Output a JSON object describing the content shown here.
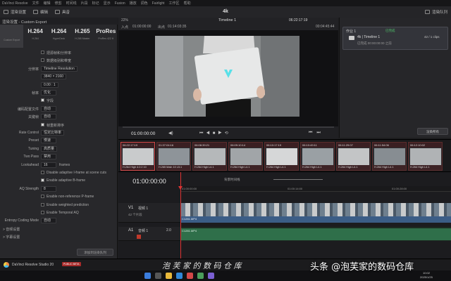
{
  "menubar": {
    "items": [
      "DaVinci Resolve",
      "文件",
      "编辑",
      "修剪",
      "时间线",
      "片段",
      "标记",
      "显示",
      "Fusion",
      "播放",
      "调色",
      "Fairlight",
      "工作区",
      "帮助"
    ]
  },
  "toolbar": {
    "render_label": "渲染设置",
    "media_label": "编辑",
    "quality_label": "具音",
    "project_title": "4k",
    "render_queue_label": "渲染队列"
  },
  "viewer": {
    "zoom": "22%",
    "tc_in": "01:00:00:00",
    "tc_out": "01:14:03:35",
    "timeline_name": "Timeline 1",
    "timecode": "06:22:17:19",
    "duration": "00:04:45:44",
    "in_label": "入点",
    "out_label": "出点",
    "current_tc": "01:00:00:00"
  },
  "left": {
    "header": "渲染设置 - Custom Export",
    "presets": [
      {
        "big": "",
        "small": "Custom Export"
      },
      {
        "big": "H.264",
        "small": "H.264"
      },
      {
        "big": "H.264",
        "small": "HyperDeck"
      },
      {
        "big": "H.265",
        "small": "H.265 Master"
      },
      {
        "big": "ProRes",
        "small": "ProRes 422 H"
      }
    ],
    "rows": [
      {
        "type": "check",
        "on": false,
        "text": "把源帧和分辨率"
      },
      {
        "type": "check",
        "on": false,
        "text": "数据级别和带宽"
      },
      {
        "label": "分辨率",
        "value": "Timeline Resolution"
      },
      {
        "label": "",
        "value": "3840  ×  2160"
      },
      {
        "label": "",
        "value": "0.00 : 1"
      },
      {
        "label": "帧率",
        "value": "优化"
      },
      {
        "type": "check",
        "on": true,
        "text": "字段"
      },
      {
        "label": "编码配置文件",
        "value": "自动"
      },
      {
        "label": "关键帧",
        "value": "自动"
      },
      {
        "type": "check",
        "on": true,
        "text": "帧重新排序"
      },
      {
        "label": "Rate Control",
        "value": "恒定比特率"
      },
      {
        "label": "Preset",
        "value": "慢速"
      },
      {
        "label": "Tuning",
        "value": "高质量"
      },
      {
        "label": "Two Pass",
        "value": "禁用"
      },
      {
        "label": "Lookahead",
        "value": "16",
        "suffix": "frames"
      },
      {
        "type": "check",
        "on": false,
        "text": "Disable adaptive I-frame at scene cuts"
      },
      {
        "type": "check",
        "on": true,
        "text": "Enable adaptive B-frame"
      },
      {
        "label": "AQ Strength",
        "value": "8"
      },
      {
        "type": "check",
        "on": false,
        "text": "Enable non-reference P-frame"
      },
      {
        "type": "check",
        "on": false,
        "text": "Enable weighted prediction"
      },
      {
        "type": "check",
        "on": false,
        "text": "Enable Temporal AQ"
      },
      {
        "label": "Entropy Coding Mode",
        "value": "自动"
      },
      {
        "type": "section",
        "text": "> 音频设置"
      },
      {
        "type": "section",
        "text": "> 字幕设置"
      }
    ],
    "render_button": "添加到渲染队列"
  },
  "queue": {
    "title": "渲染队列",
    "item": {
      "name": "作业 1",
      "timeline": "4k | Timeline 1",
      "detail": "42 / 1 clips",
      "status": "已完成",
      "subtext": "已完成 00:00:00:00 之前"
    },
    "button": "渲染所有"
  },
  "clips": [
    {
      "num": "01",
      "tc": "06:22:17:19",
      "name": "H.264 High 4:2:2 10"
    },
    {
      "num": "02",
      "tc": "01:37:04:16",
      "name": "H.265 Main 10 L5.1"
    },
    {
      "num": "03",
      "tc": "06:08:39:21",
      "name": "H.264 High L4.1"
    },
    {
      "num": "04",
      "tc": "06:09:10:14",
      "name": "H.264 High L4.1"
    },
    {
      "num": "05",
      "tc": "06:10:17:19",
      "name": "H.264 High L4.1"
    },
    {
      "num": "06",
      "tc": "06:10:49:11",
      "name": "H.264 High L4.1"
    },
    {
      "num": "07",
      "tc": "06:11:29:07",
      "name": "H.264 High L4.1"
    },
    {
      "num": "08",
      "tc": "06:11:54:06",
      "name": "H.264 High L4.1"
    },
    {
      "num": "09",
      "tc": "06:12:10:02",
      "name": "H.264 High L4.1"
    }
  ],
  "timeline": {
    "timecode": "01:00:00:00",
    "ruler": [
      "01:00:00:00",
      "01:00:14:00",
      "01:00:28:00"
    ],
    "v1": {
      "label": "V1",
      "name": "视频 1",
      "sub": "42 个片段",
      "clip": "C1281.MP4"
    },
    "a1": {
      "label": "A1",
      "name": "音频 1",
      "level": "2.0",
      "clip": "C1281.MP4"
    },
    "track_height_label": "背景时间线"
  },
  "bottombar": {
    "app": "DaVinci Resolve Studio 20",
    "badge": "PUBLIC BETA"
  },
  "taskbar": {
    "time": "10:02",
    "date": "2025/1/25"
  },
  "watermark": {
    "main": "头条 @泡芙家的数码仓库",
    "overlay": "泡 芙 家 的 数 码 仓 库"
  }
}
